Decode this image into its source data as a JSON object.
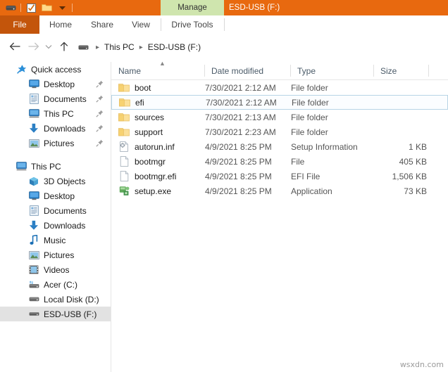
{
  "window": {
    "title": "ESD-USB (F:)",
    "contextual_tab": "Manage",
    "quick_access_icons": [
      "drive-icon",
      "properties-checkbox-icon",
      "new-folder-icon",
      "customize-chevron-icon"
    ]
  },
  "ribbon": {
    "file_tab": "File",
    "tabs": [
      "Home",
      "Share",
      "View"
    ],
    "tool_tab": "Drive Tools"
  },
  "nav": {
    "back": "back-arrow",
    "forward": "forward-arrow",
    "recent": "recent-chevron",
    "up": "up-arrow",
    "breadcrumb": [
      "This PC",
      "ESD-USB (F:)"
    ]
  },
  "sidebar": {
    "quick_access": {
      "label": "Quick access",
      "icon": "star-pin-icon",
      "items": [
        {
          "label": "Desktop",
          "icon": "desktop-icon",
          "pinned": true
        },
        {
          "label": "Documents",
          "icon": "documents-icon",
          "pinned": true
        },
        {
          "label": "This PC",
          "icon": "computer-icon",
          "pinned": true
        },
        {
          "label": "Downloads",
          "icon": "downloads-icon",
          "pinned": true
        },
        {
          "label": "Pictures",
          "icon": "pictures-icon",
          "pinned": true
        }
      ]
    },
    "this_pc": {
      "label": "This PC",
      "icon": "computer-icon",
      "items": [
        {
          "label": "3D Objects",
          "icon": "3d-objects-icon"
        },
        {
          "label": "Desktop",
          "icon": "desktop-icon"
        },
        {
          "label": "Documents",
          "icon": "documents-icon"
        },
        {
          "label": "Downloads",
          "icon": "downloads-icon"
        },
        {
          "label": "Music",
          "icon": "music-icon"
        },
        {
          "label": "Pictures",
          "icon": "pictures-icon"
        },
        {
          "label": "Videos",
          "icon": "videos-icon"
        },
        {
          "label": "Acer (C:)",
          "icon": "hdd-icon"
        },
        {
          "label": "Local Disk (D:)",
          "icon": "hdd-icon"
        },
        {
          "label": "ESD-USB (F:)",
          "icon": "usb-drive-icon",
          "active": true
        }
      ]
    }
  },
  "filelist": {
    "columns": [
      "Name",
      "Date modified",
      "Type",
      "Size"
    ],
    "sort_column": "Name",
    "sort_direction": "ascending",
    "rows": [
      {
        "name": "boot",
        "icon": "folder-icon",
        "date": "7/30/2021 2:12 AM",
        "type": "File folder",
        "size": "",
        "selected": false
      },
      {
        "name": "efi",
        "icon": "folder-icon",
        "date": "7/30/2021 2:12 AM",
        "type": "File folder",
        "size": "",
        "selected": true
      },
      {
        "name": "sources",
        "icon": "folder-icon",
        "date": "7/30/2021 2:13 AM",
        "type": "File folder",
        "size": "",
        "selected": false
      },
      {
        "name": "support",
        "icon": "folder-icon",
        "date": "7/30/2021 2:23 AM",
        "type": "File folder",
        "size": "",
        "selected": false
      },
      {
        "name": "autorun.inf",
        "icon": "setup-info-icon",
        "date": "4/9/2021 8:25 PM",
        "type": "Setup Information",
        "size": "1 KB",
        "selected": false
      },
      {
        "name": "bootmgr",
        "icon": "blank-file-icon",
        "date": "4/9/2021 8:25 PM",
        "type": "File",
        "size": "405 KB",
        "selected": false
      },
      {
        "name": "bootmgr.efi",
        "icon": "blank-file-icon",
        "date": "4/9/2021 8:25 PM",
        "type": "EFI File",
        "size": "1,506 KB",
        "selected": false
      },
      {
        "name": "setup.exe",
        "icon": "application-icon",
        "date": "4/9/2021 8:25 PM",
        "type": "Application",
        "size": "73 KB",
        "selected": false
      }
    ]
  },
  "watermark": "wsxdn.com",
  "colors": {
    "titlebar": "#e8690f",
    "file_tab": "#c3550b",
    "contextual_tab": "#cfe5ae",
    "folder": "#f7d272",
    "selection_border": "#b7d4e5",
    "sidebar_active": "#e2e2e2"
  }
}
